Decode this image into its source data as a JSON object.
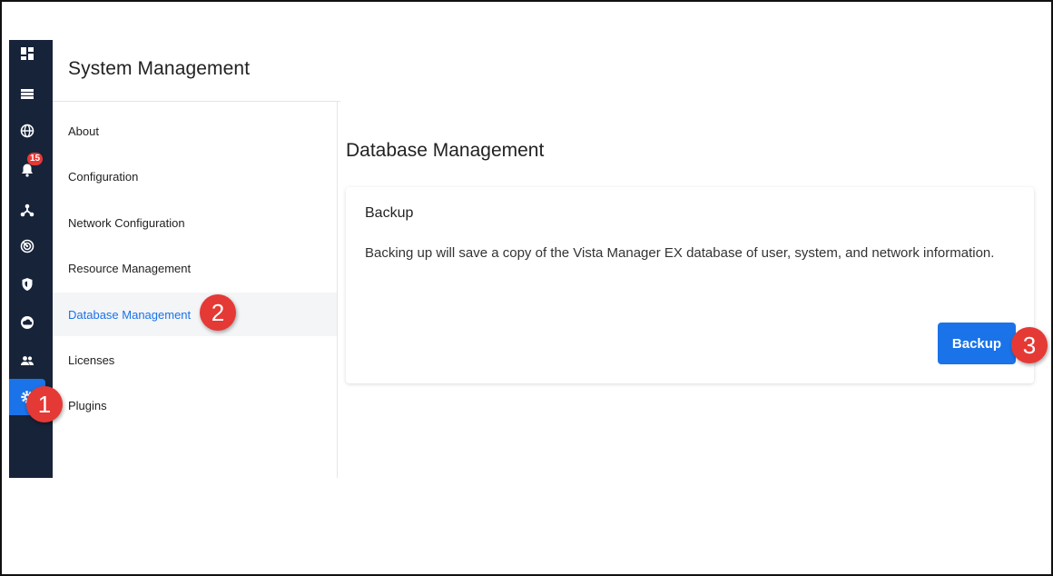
{
  "colors": {
    "rail_bg": "#172339",
    "accent": "#1a73e8",
    "badge": "#e53935",
    "callout": "#e53935"
  },
  "sidebar": {
    "items": [
      {
        "icon": "dashboard-icon"
      },
      {
        "icon": "list-icon"
      },
      {
        "icon": "globe-icon"
      },
      {
        "icon": "bell-icon",
        "badge": "15"
      },
      {
        "icon": "network-icon"
      },
      {
        "icon": "radar-icon"
      },
      {
        "icon": "shield-icon"
      },
      {
        "icon": "cloud-icon"
      },
      {
        "icon": "users-icon"
      },
      {
        "icon": "gear-icon",
        "active": true
      }
    ]
  },
  "header": {
    "title": "System Management"
  },
  "subnav": {
    "items": [
      {
        "label": "About"
      },
      {
        "label": "Configuration"
      },
      {
        "label": "Network Configuration"
      },
      {
        "label": "Resource Management"
      },
      {
        "label": "Database Management",
        "selected": true
      },
      {
        "label": "Licenses"
      },
      {
        "label": "Plugins"
      }
    ]
  },
  "main": {
    "section_title": "Database Management",
    "card": {
      "title": "Backup",
      "description": "Backing up will save a copy of the Vista Manager EX database of user, system, and network information.",
      "button_label": "Backup"
    }
  },
  "callouts": [
    "1",
    "2",
    "3"
  ]
}
